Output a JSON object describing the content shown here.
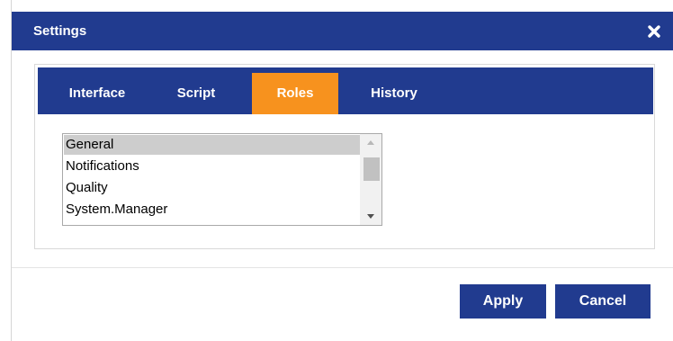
{
  "dialog": {
    "title": "Settings",
    "close_icon": "close-icon"
  },
  "tabs": [
    {
      "label": "Interface",
      "active": false
    },
    {
      "label": "Script",
      "active": false
    },
    {
      "label": "Roles",
      "active": true
    },
    {
      "label": "History",
      "active": false
    }
  ],
  "roles_list": {
    "selected": "General",
    "items": [
      "General",
      "Notifications",
      "Quality",
      "System.Manager"
    ]
  },
  "buttons": {
    "apply_label": "Apply",
    "cancel_label": "Cancel"
  },
  "colors": {
    "header_blue": "#213b8f",
    "active_tab_orange": "#f7921e",
    "selected_item_gray": "#cdcdcd"
  }
}
